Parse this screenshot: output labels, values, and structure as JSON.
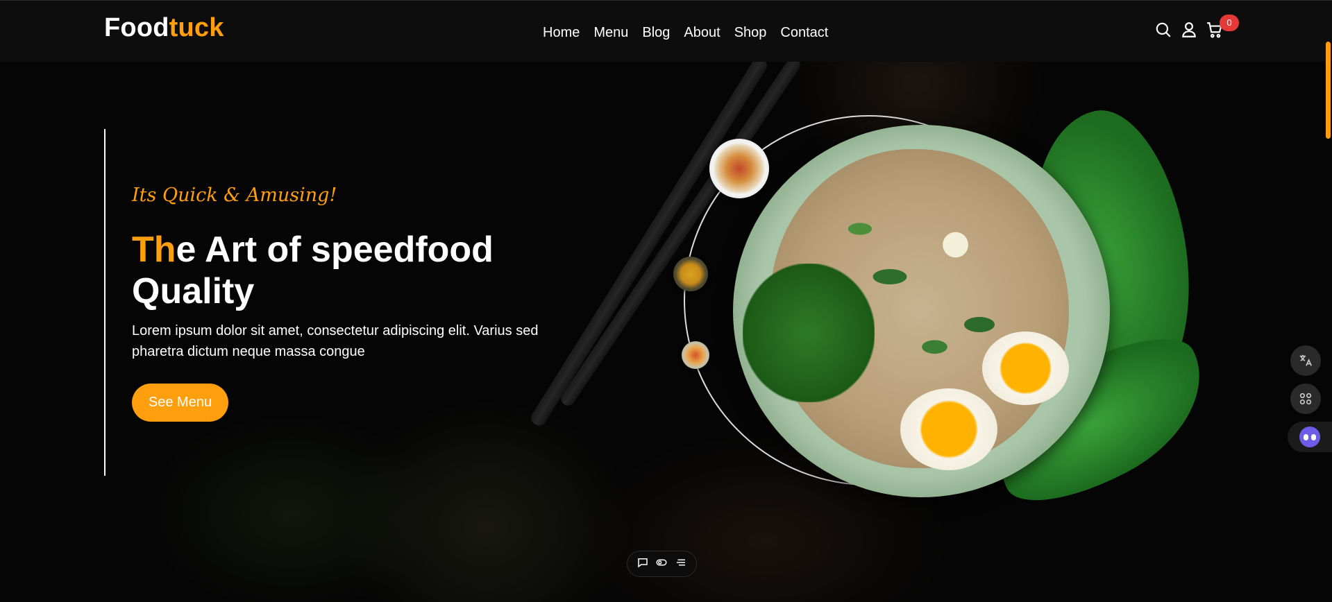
{
  "brand": {
    "part1": "Food",
    "part2": "tuck",
    "accent_color": "#ff9f0d"
  },
  "nav": {
    "items": [
      {
        "label": "Home"
      },
      {
        "label": "Menu"
      },
      {
        "label": "Blog"
      },
      {
        "label": "About"
      },
      {
        "label": "Shop"
      },
      {
        "label": "Contact"
      }
    ]
  },
  "header_icons": {
    "search": "search-icon",
    "user": "user-icon",
    "cart": "cart-icon",
    "cart_count": "0"
  },
  "hero": {
    "tagline": "Its Quick & Amusing!",
    "headline_accent": "Th",
    "headline_rest": "e Art of speedfood Quality",
    "description": "Lorem ipsum dolor sit amet, consectetur adipiscing elit. Varius sed pharetra dictum neque massa congue",
    "cta_label": "See Menu"
  },
  "mini_toolbar": {
    "icons": [
      "chat-icon",
      "toggle-icon",
      "list-icon"
    ]
  },
  "side_widget": {
    "icons": [
      "translate-icon",
      "apps-icon",
      "assistant-bot-icon"
    ]
  }
}
